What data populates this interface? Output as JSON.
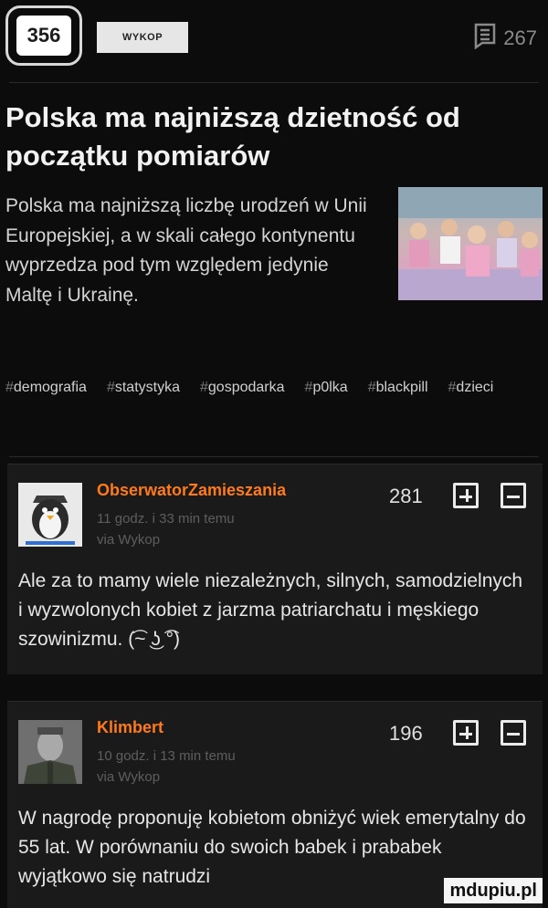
{
  "header": {
    "votes": "356",
    "source": "WYKOP",
    "comments_count": "267"
  },
  "article": {
    "title": "Polska ma najniższą dzietność od początku pomiarów",
    "description": "Polska ma najniższą liczbę urodzeń w Unii Europejskiej, a w skali całego kontynentu wyprzedza pod tym względem jedynie Maltę i Ukrainę.",
    "tags": [
      "demografia",
      "statystyka",
      "gospodarka",
      "p0lka",
      "blackpill",
      "dzieci"
    ]
  },
  "comments": [
    {
      "author": "ObserwatorZamieszania",
      "time": "11 godz. i 33 min temu",
      "via": "via Wykop",
      "score": "281",
      "text": "Ale za to mamy wiele niezależnych, silnych, samodzielnych i wyzwolonych kobiet z jarzma patriarchatu i męskiego szowinizmu. (͡~ ͜ʖ ͡°)"
    },
    {
      "author": "Klimbert",
      "time": "10 godz. i 13 min temu",
      "via": "via Wykop",
      "score": "196",
      "text": "W nagrodę proponuję kobietom obniżyć wiek emerytalny do 55 lat. W porównaniu do swoich babek i prababek wyjątkowo się natrudzi"
    }
  ],
  "watermark": "mdupiu.pl",
  "colors": {
    "accent": "#ff7a1a",
    "background": "#0c0c0c",
    "card": "#1a1a1a"
  }
}
